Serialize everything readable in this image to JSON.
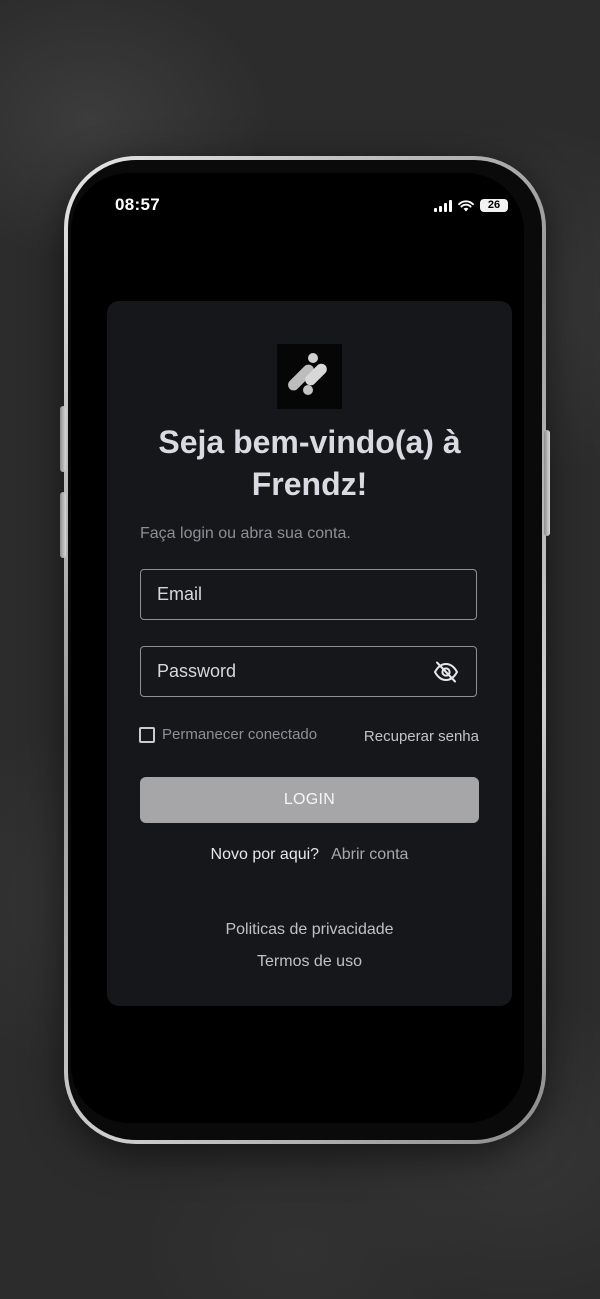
{
  "status_bar": {
    "time": "08:57",
    "battery": "26",
    "icons": [
      "cellular-signal-icon",
      "wifi-icon",
      "battery-icon"
    ]
  },
  "logo": {
    "icon": "frendz-logo-icon"
  },
  "login": {
    "title": "Seja bem-vindo(a) à Frendz!",
    "subtitle": "Faça login ou abra sua conta.",
    "email_placeholder": "Email",
    "password_placeholder": "Password",
    "password_toggle_icon": "eye-slash-icon",
    "remember_label": "Permanecer conectado",
    "remember_checked": false,
    "recover_label": "Recuperar senha",
    "login_button": "LOGIN",
    "signup_prompt": "Novo por aqui?",
    "signup_link": "Abrir conta"
  },
  "footer": {
    "privacy": "Politicas de privacidade",
    "terms": "Termos de uso"
  },
  "colors": {
    "card_bg": "#16171b",
    "button_bg": "#a6a6a8",
    "title": "#d9dbe3",
    "muted_text": "#8c8f97"
  }
}
